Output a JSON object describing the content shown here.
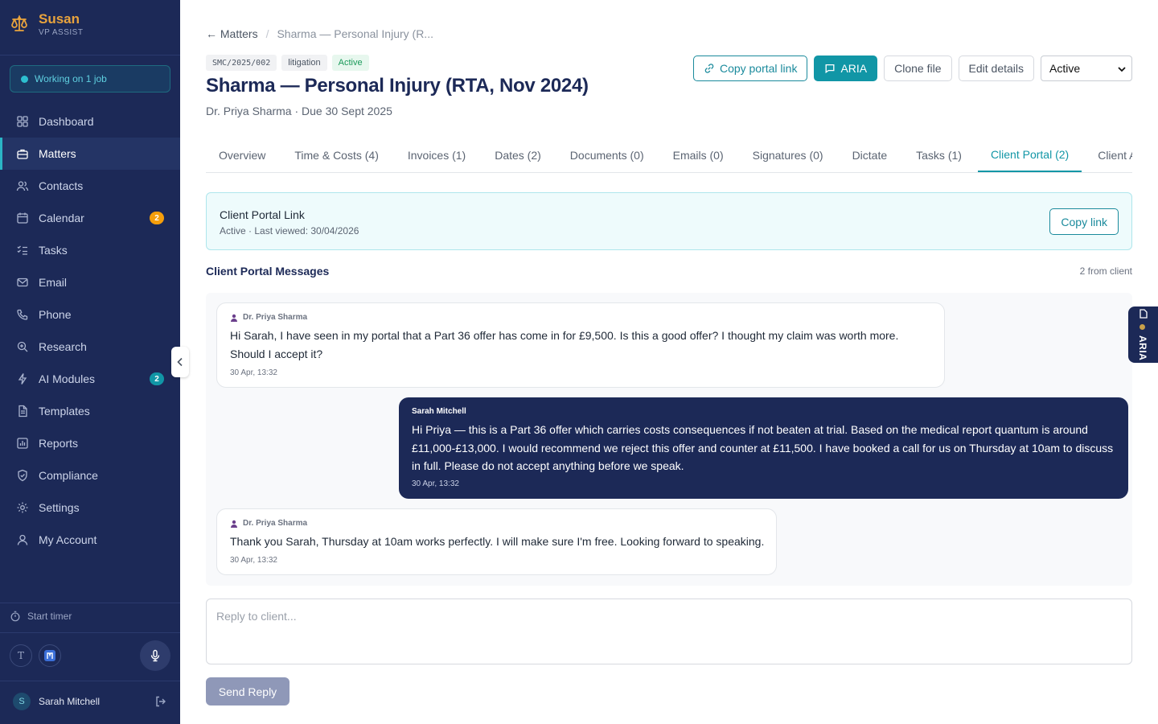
{
  "colors": {
    "sidebar_bg": "#1c2957",
    "brand_accent": "#e8a33d",
    "teal_accent": "#1196a6",
    "badge_amber": "#f59e0b",
    "badge_teal": "#1196a6",
    "status_green": "#1a9a5a"
  },
  "brand": {
    "name": "Susan",
    "subtitle": "VP ASSIST",
    "icon": "scales-icon"
  },
  "job_status": "Working on 1 job",
  "nav": [
    {
      "label": "Dashboard",
      "icon": "grid-icon"
    },
    {
      "label": "Matters",
      "icon": "briefcase-icon",
      "active": true
    },
    {
      "label": "Contacts",
      "icon": "users-icon"
    },
    {
      "label": "Calendar",
      "icon": "calendar-icon",
      "badge": "2"
    },
    {
      "label": "Tasks",
      "icon": "checklist-icon"
    },
    {
      "label": "Email",
      "icon": "mail-icon"
    },
    {
      "label": "Phone",
      "icon": "phone-icon"
    },
    {
      "label": "Research",
      "icon": "zoom-icon"
    },
    {
      "label": "AI Modules",
      "icon": "lightning-icon",
      "badge": "2"
    },
    {
      "label": "Templates",
      "icon": "document-icon"
    },
    {
      "label": "Reports",
      "icon": "chart-icon"
    },
    {
      "label": "Compliance",
      "icon": "shield-icon"
    },
    {
      "label": "Settings",
      "icon": "gear-icon"
    },
    {
      "label": "My Account",
      "icon": "user-icon"
    }
  ],
  "timer_label": "Start timer",
  "tools": {
    "t_label": "T"
  },
  "user": {
    "initial": "S",
    "name": "Sarah Mitchell"
  },
  "breadcrumb": {
    "back": "← Matters",
    "current": "Sharma — Personal Injury (R..."
  },
  "matter": {
    "ref": "SMC/2025/002",
    "type": "litigation",
    "status": "Active",
    "title": "Sharma — Personal Injury (RTA, Nov 2024)",
    "client": "Dr. Priya Sharma",
    "due": "· Due 30 Sept 2025"
  },
  "actions": {
    "copy_portal": "Copy portal link",
    "aria": "ARIA",
    "clone": "Clone file",
    "edit": "Edit details",
    "status_select": "Active"
  },
  "tabs": [
    "Overview",
    "Time & Costs (4)",
    "Invoices (1)",
    "Dates (2)",
    "Documents (0)",
    "Emails (0)",
    "Signatures (0)",
    "Dictate",
    "Tasks (1)",
    "Client Portal (2)",
    "Client Access"
  ],
  "active_tab_index": 9,
  "portal": {
    "title": "Client Portal Link",
    "meta": "Active · Last viewed: 30/04/2026",
    "copy_label": "Copy link"
  },
  "messages_section": {
    "title": "Client Portal Messages",
    "count": "2 from client"
  },
  "messages": [
    {
      "sender": "Dr. Priya Sharma",
      "from": "client",
      "body": "Hi Sarah, I have seen in my portal that a Part 36 offer has come in for £9,500. Is this a good offer? I thought my claim was worth more. Should I accept it?",
      "time": "30 Apr, 13:32"
    },
    {
      "sender": "Sarah Mitchell",
      "from": "staff",
      "body": "Hi Priya — this is a Part 36 offer which carries costs consequences if not beaten at trial. Based on the medical report quantum is around £11,000-£13,000. I would recommend we reject this offer and counter at £11,500. I have booked a call for us on Thursday at 10am to discuss in full. Please do not accept anything before we speak.",
      "time": "30 Apr, 13:32"
    },
    {
      "sender": "Dr. Priya Sharma",
      "from": "client",
      "body": "Thank you Sarah, Thursday at 10am works perfectly. I will make sure I'm free. Looking forward to speaking.",
      "time": "30 Apr, 13:32"
    }
  ],
  "reply": {
    "placeholder": "Reply to client...",
    "send_label": "Send Reply"
  },
  "aria_tab": {
    "label": "ARIA"
  }
}
